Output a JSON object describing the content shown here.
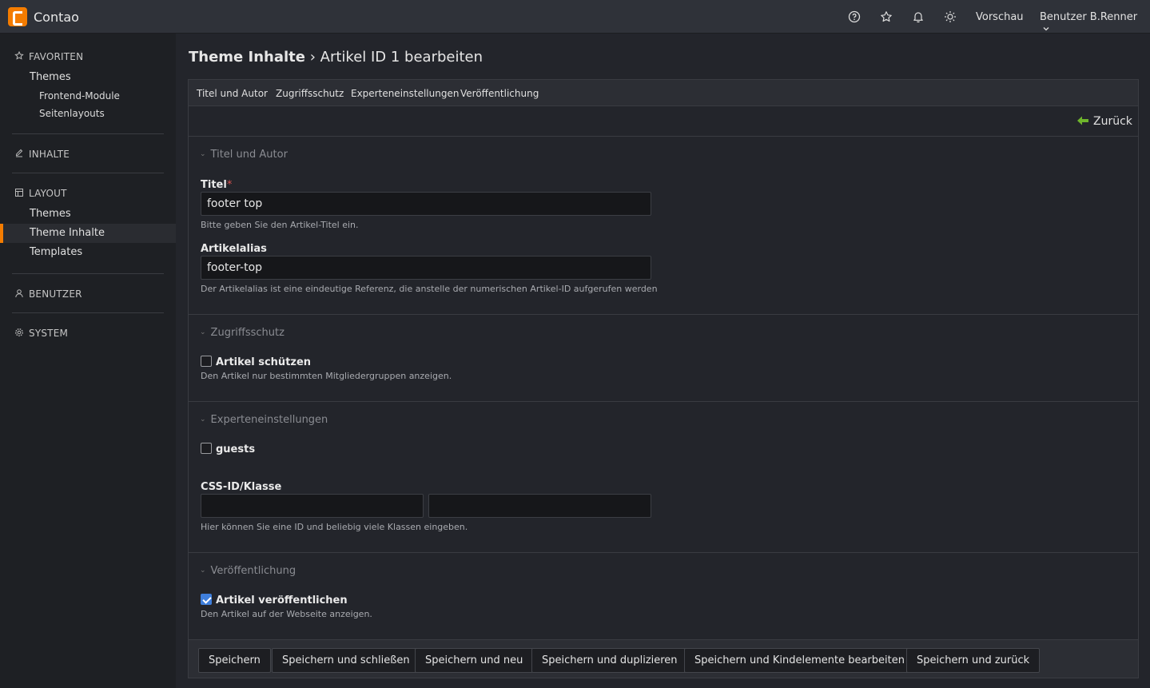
{
  "header": {
    "brand": "Contao",
    "icons": [
      "help-icon",
      "star-icon",
      "bell-icon",
      "sun-icon"
    ],
    "preview": "Vorschau",
    "user": "Benutzer B.Renner"
  },
  "sidebar": {
    "favorites": {
      "label": "FAVORITEN",
      "items": [
        "Themes"
      ],
      "sub_items": [
        "Frontend-Module",
        "Seitenlayouts"
      ]
    },
    "inhalte": {
      "label": "INHALTE"
    },
    "layout": {
      "label": "LAYOUT",
      "items": [
        "Themes",
        "Theme Inhalte",
        "Templates"
      ],
      "active": "Theme Inhalte"
    },
    "benutzer": {
      "label": "BENUTZER"
    },
    "system": {
      "label": "SYSTEM"
    }
  },
  "page": {
    "title_bold": "Theme Inhalte",
    "title_rest": " › Artikel ID 1 bearbeiten"
  },
  "tabs": [
    "Titel und Autor",
    "Zugriffsschutz",
    "Experteneinstellungen",
    "Veröffentlichung"
  ],
  "back_label": "Zurück",
  "sections": {
    "title_author": {
      "legend": "Titel und Autor",
      "title_label": "Titel",
      "title_required": "*",
      "title_value": "footer top",
      "title_help": "Bitte geben Sie den Artikel-Titel ein.",
      "alias_label": "Artikelalias",
      "alias_value": "footer-top",
      "alias_help": "Der Artikelalias ist eine eindeutige Referenz, die anstelle der numerischen Artikel-ID aufgerufen werden"
    },
    "access": {
      "legend": "Zugriffsschutz",
      "protect_label": "Artikel schützen",
      "protect_checked": false,
      "protect_help": "Den Artikel nur bestimmten Mitgliedergruppen anzeigen."
    },
    "expert": {
      "legend": "Experteneinstellungen",
      "guests_label": "guests",
      "guests_checked": false,
      "css_label": "CSS-ID/Klasse",
      "css_id": "",
      "css_class": "",
      "css_help": "Hier können Sie eine ID und beliebig viele Klassen eingeben."
    },
    "publish": {
      "legend": "Veröffentlichung",
      "publish_label": "Artikel veröffentlichen",
      "publish_checked": true,
      "publish_help": "Den Artikel auf der Webseite anzeigen."
    }
  },
  "buttons": {
    "save": "Speichern",
    "save_close": "Speichern und schließen",
    "save_new": "Speichern und neu",
    "save_duplicate": "Speichern und duplizieren",
    "save_children": "Speichern und Kindelemente bearbeiten",
    "save_back": "Speichern und zurück"
  }
}
